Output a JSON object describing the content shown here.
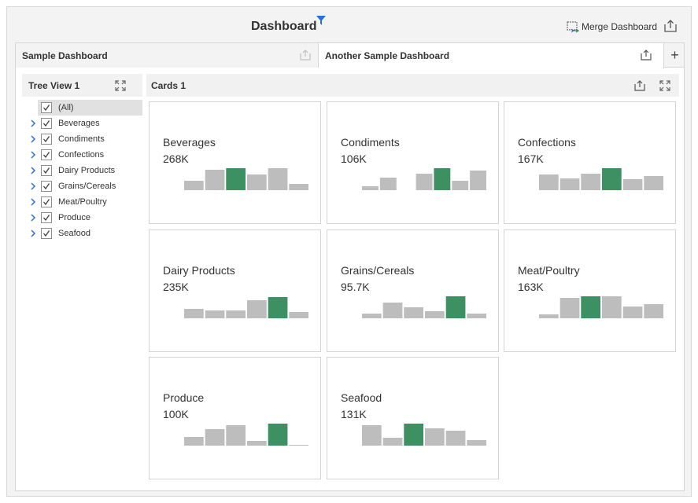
{
  "header": {
    "title": "Dashboard",
    "merge_label": "Merge Dashboard"
  },
  "tabs": [
    {
      "label": "Sample Dashboard",
      "active": false
    },
    {
      "label": "Another Sample Dashboard",
      "active": true
    }
  ],
  "add_tab_label": "+",
  "tree": {
    "title": "Tree View 1",
    "items": [
      {
        "label": "(All)",
        "checked": true
      },
      {
        "label": "Beverages",
        "checked": true
      },
      {
        "label": "Condiments",
        "checked": true
      },
      {
        "label": "Confections",
        "checked": true
      },
      {
        "label": "Dairy Products",
        "checked": true
      },
      {
        "label": "Grains/Cereals",
        "checked": true
      },
      {
        "label": "Meat/Poultry",
        "checked": true
      },
      {
        "label": "Produce",
        "checked": true
      },
      {
        "label": "Seafood",
        "checked": true
      }
    ]
  },
  "cards_panel": {
    "title": "Cards 1",
    "cards": [
      {
        "title": "Beverages",
        "value": "268K",
        "sparkline": [
          12,
          26,
          28,
          20,
          28,
          8
        ],
        "highlight": 2
      },
      {
        "title": "Condiments",
        "value": "106K",
        "sparkline": [
          5,
          16,
          0,
          21,
          28,
          12,
          25
        ],
        "highlight": 4
      },
      {
        "title": "Confections",
        "value": "167K",
        "sparkline": [
          20,
          15,
          21,
          28,
          14,
          18
        ],
        "highlight": 3
      },
      {
        "title": "Dairy Products",
        "value": "235K",
        "sparkline": [
          12,
          10,
          10,
          23,
          27,
          8
        ],
        "highlight": 4
      },
      {
        "title": "Grains/Cereals",
        "value": "95.7K",
        "sparkline": [
          6,
          20,
          14,
          9,
          28,
          6
        ],
        "highlight": 4
      },
      {
        "title": "Meat/Poultry",
        "value": "163K",
        "sparkline": [
          5,
          26,
          28,
          28,
          15,
          18
        ],
        "highlight": 2
      },
      {
        "title": "Produce",
        "value": "100K",
        "sparkline": [
          11,
          21,
          26,
          6,
          28,
          1
        ],
        "highlight": 4
      },
      {
        "title": "Seafood",
        "value": "131K",
        "sparkline": [
          26,
          10,
          28,
          22,
          19,
          7
        ],
        "highlight": 2
      }
    ]
  },
  "colors": {
    "bar": "#bdbdbd",
    "bar_highlight": "#3c9061",
    "accent_blue": "#2a6fd6"
  },
  "icons": [
    "filter-icon",
    "merge-dashboard-icon",
    "export-icon",
    "maximize-icon",
    "chevron-right-icon",
    "checkmark-icon",
    "plus-icon"
  ]
}
